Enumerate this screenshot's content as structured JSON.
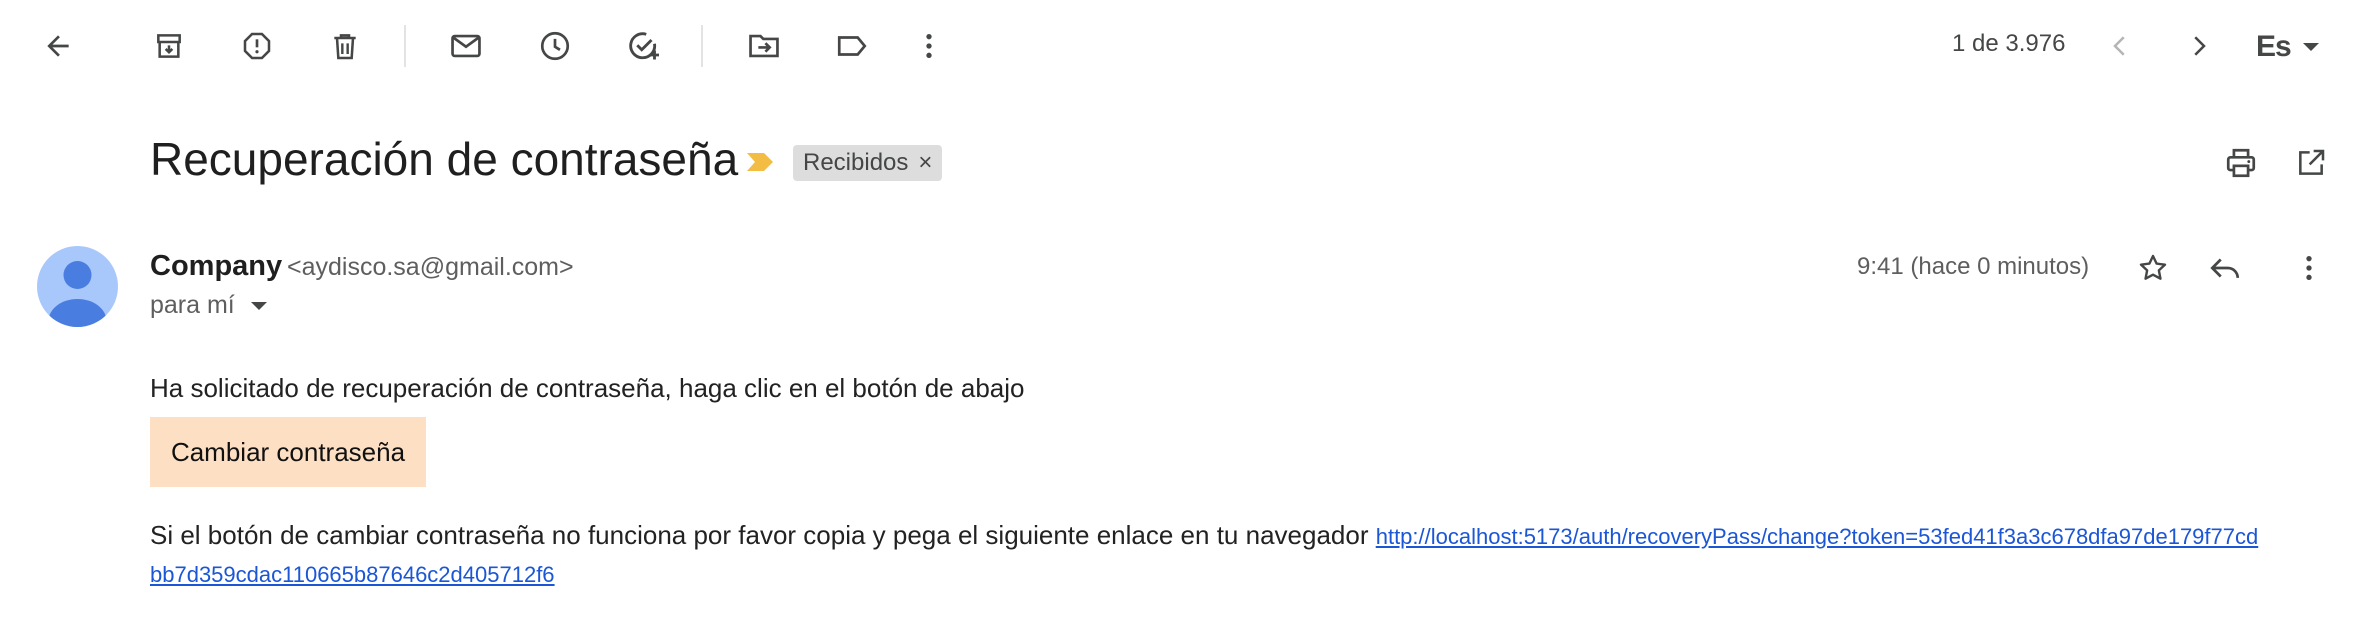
{
  "toolbar": {
    "icons": [
      "back-arrow-icon",
      "archive-icon",
      "report-spam-icon",
      "delete-icon",
      "mark-unread-icon",
      "snooze-icon",
      "add-to-tasks-icon",
      "move-to-icon",
      "label-icon",
      "more-vert-icon"
    ],
    "counter": "1 de 3.976",
    "language": "Es"
  },
  "email": {
    "subject": "Recuperación de contraseña",
    "label": "Recibidos",
    "label_remove": "×",
    "sender_name": "Company",
    "sender_email": "<aydisco.sa@gmail.com>",
    "to_line": "para mí",
    "timestamp": "9:41 (hace 0 minutos)",
    "body": {
      "intro": "Ha solicitado de recuperación de contraseña, haga clic en el botón de abajo",
      "button_label": "Cambiar contraseña",
      "fallback_text": "Si el botón de cambiar contraseña no funciona por favor copia y pega el siguiente enlace en tu navegador",
      "link": "http://localhost:5173/auth/recoveryPass/change?token=53fed41f3a3c678dfa97de179f77cdbb7d359cdac110665b87646c2d405712f6"
    }
  },
  "colors": {
    "accent_important": "#f2bd42",
    "avatar_bg": "#a8c7fa",
    "avatar_fg": "#4a7de0",
    "button_bg": "#fde0c4",
    "link": "#1a56d6"
  }
}
